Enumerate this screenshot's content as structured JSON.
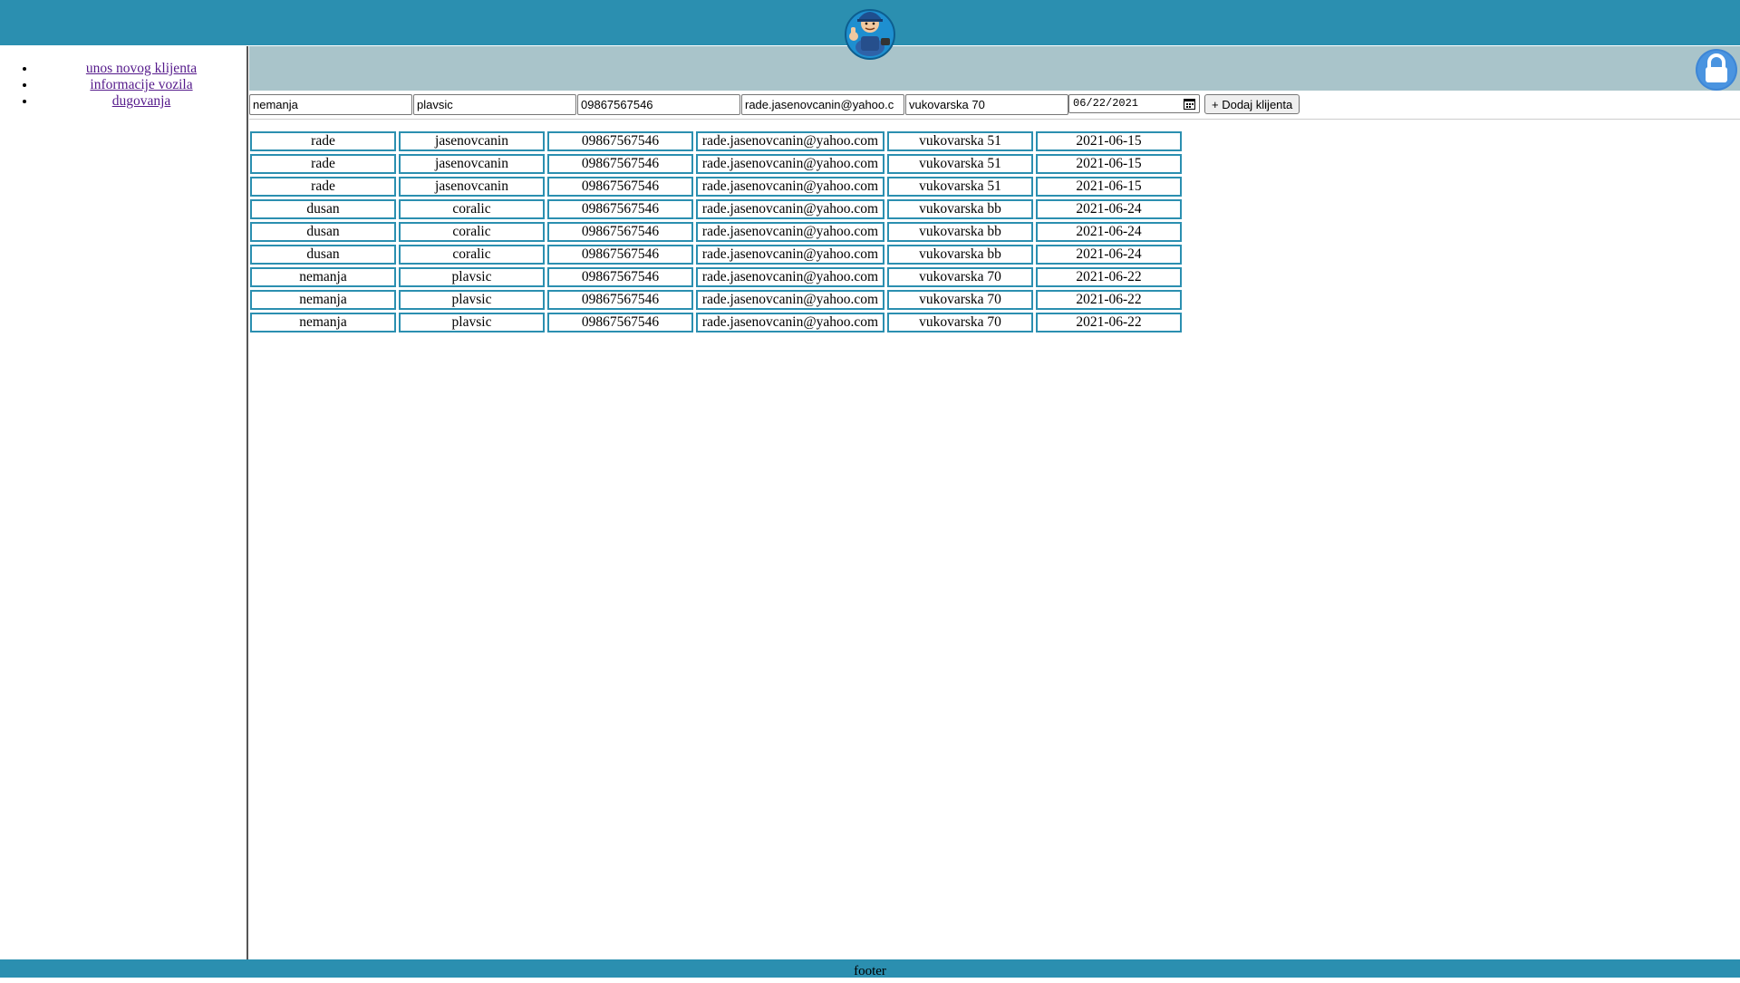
{
  "nav": {
    "items": [
      {
        "label": "unos novog klijenta"
      },
      {
        "label": "informacije vozila"
      },
      {
        "label": "dugovanja"
      }
    ]
  },
  "form": {
    "first_name": "nemanja",
    "last_name": "plavsic",
    "phone": "09867567546",
    "email": "rade.jasenovcanin@yahoo.c",
    "address": "vukovarska 70",
    "date": "06/22/2021",
    "add_button_label": "+ Dodaj klijenta"
  },
  "table": {
    "rows": [
      [
        "rade",
        "jasenovcanin",
        "09867567546",
        "rade.jasenovcanin@yahoo.com",
        "vukovarska 51",
        "2021-06-15"
      ],
      [
        "rade",
        "jasenovcanin",
        "09867567546",
        "rade.jasenovcanin@yahoo.com",
        "vukovarska 51",
        "2021-06-15"
      ],
      [
        "rade",
        "jasenovcanin",
        "09867567546",
        "rade.jasenovcanin@yahoo.com",
        "vukovarska 51",
        "2021-06-15"
      ],
      [
        "dusan",
        "coralic",
        "09867567546",
        "rade.jasenovcanin@yahoo.com",
        "vukovarska bb",
        "2021-06-24"
      ],
      [
        "dusan",
        "coralic",
        "09867567546",
        "rade.jasenovcanin@yahoo.com",
        "vukovarska bb",
        "2021-06-24"
      ],
      [
        "dusan",
        "coralic",
        "09867567546",
        "rade.jasenovcanin@yahoo.com",
        "vukovarska bb",
        "2021-06-24"
      ],
      [
        "nemanja",
        "plavsic",
        "09867567546",
        "rade.jasenovcanin@yahoo.com",
        "vukovarska 70",
        "2021-06-22"
      ],
      [
        "nemanja",
        "plavsic",
        "09867567546",
        "rade.jasenovcanin@yahoo.com",
        "vukovarska 70",
        "2021-06-22"
      ],
      [
        "nemanja",
        "plavsic",
        "09867567546",
        "rade.jasenovcanin@yahoo.com",
        "vukovarska 70",
        "2021-06-22"
      ]
    ]
  },
  "footer": {
    "text": "footer"
  },
  "colors": {
    "header": "#2b8fb0",
    "subheader": "#a9c4ca",
    "cell_border": "#2b8fb0",
    "link": "#551a8b"
  },
  "icons": {
    "logo": "mechanic-logo-icon",
    "lock": "lock-icon",
    "calendar": "calendar-icon"
  }
}
